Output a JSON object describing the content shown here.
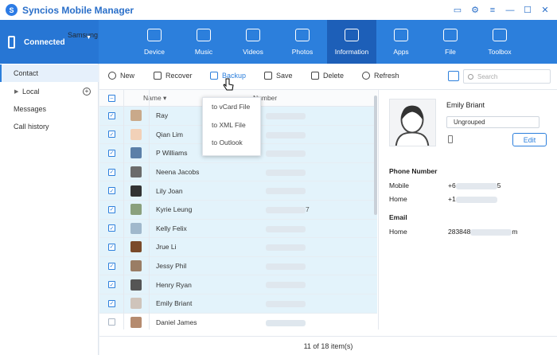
{
  "app": {
    "title": "Syncios Mobile Manager",
    "window_controls": [
      "chat-icon",
      "gear-icon",
      "menu-icon",
      "minimize-icon",
      "maximize-icon",
      "close-icon"
    ]
  },
  "device": {
    "name": "Samsung",
    "status": "Connected"
  },
  "nav": [
    {
      "label": "Device",
      "icon": "home-icon"
    },
    {
      "label": "Music",
      "icon": "music-note-icon"
    },
    {
      "label": "Videos",
      "icon": "film-icon"
    },
    {
      "label": "Photos",
      "icon": "picture-icon"
    },
    {
      "label": "Information",
      "icon": "contact-card-icon",
      "active": true
    },
    {
      "label": "Apps",
      "icon": "apps-grid-icon"
    },
    {
      "label": "File",
      "icon": "folder-icon"
    },
    {
      "label": "Toolbox",
      "icon": "toolbox-icon"
    }
  ],
  "sidebar": {
    "contact": "Contact",
    "local": "Local",
    "messages": "Messages",
    "call_history": "Call history"
  },
  "toolbar": {
    "new": "New",
    "recover": "Recover",
    "backup": "Backup",
    "save": "Save",
    "delete": "Delete",
    "refresh": "Refresh",
    "search_placeholder": "Search"
  },
  "backup_menu": [
    "to vCard File",
    "to XML File",
    "to Outlook"
  ],
  "table": {
    "col_name": "Name",
    "col_number": "Number",
    "rows": [
      {
        "name": "Ray",
        "number": "",
        "checked": true
      },
      {
        "name": "Qian Lim",
        "number": "",
        "checked": true
      },
      {
        "name": "P Williams",
        "number": "",
        "checked": true
      },
      {
        "name": "Neena Jacobs",
        "number": "",
        "checked": true
      },
      {
        "name": "Lily Joan",
        "number": "",
        "checked": true
      },
      {
        "name": "Kyrie Leung",
        "number": "7",
        "checked": true
      },
      {
        "name": "Kelly Felix",
        "number": "",
        "checked": true
      },
      {
        "name": "Jrue Li",
        "number": "",
        "checked": true
      },
      {
        "name": "Jessy Phil",
        "number": "",
        "checked": true
      },
      {
        "name": "Henry Ryan",
        "number": "",
        "checked": true
      },
      {
        "name": "Emily Briant",
        "number": "",
        "checked": true
      },
      {
        "name": "Daniel James",
        "number": "",
        "checked": false
      }
    ]
  },
  "footer": {
    "status": "11 of 18 item(s)"
  },
  "detail": {
    "name": "Emily Briant",
    "group": "Ungrouped",
    "edit": "Edit",
    "phone_section": "Phone Number",
    "mobile_label": "Mobile",
    "mobile_value_start": "+6",
    "mobile_value_end": "5",
    "home_label": "Home",
    "home_value_start": "+1",
    "email_section": "Email",
    "email_home_label": "Home",
    "email_value_start": "283848",
    "email_value_end": "m"
  },
  "colors": {
    "accent": "#2c7fdc",
    "nav_active": "#1d5fb8",
    "row_selected": "#e3f3fb"
  }
}
